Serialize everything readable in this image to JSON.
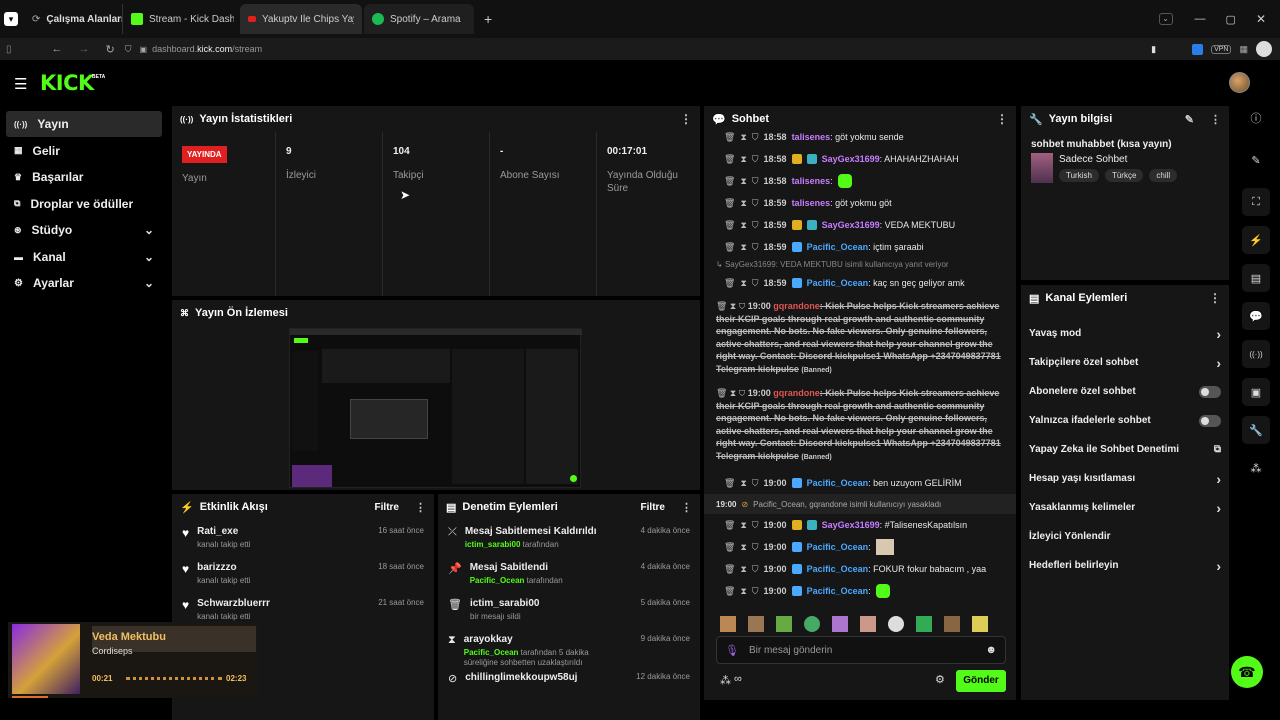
{
  "browser": {
    "tabs": [
      {
        "label": "Çalışma Alanları",
        "color": "#888"
      },
      {
        "label": "Stream - Kick Dashboard",
        "color": "#53fc18"
      },
      {
        "label": "Yakuptv İle Chips Yayında K",
        "color": "#e02020"
      },
      {
        "label": "Spotify – Arama",
        "color": "#1db954"
      }
    ],
    "url_prefix": "dashboard.",
    "url_domain": "kick.com",
    "url_path": "/stream",
    "vpn": "VPN"
  },
  "app": {
    "logo": "KICK",
    "logo_sup": "BETA"
  },
  "sidebar": {
    "items": [
      {
        "label": "Yayın",
        "icon": "broadcast-icon",
        "glyph": "((·))",
        "chev": ""
      },
      {
        "label": "Gelir",
        "icon": "income-icon",
        "glyph": "▦",
        "chev": ""
      },
      {
        "label": "Başarılar",
        "icon": "trophy-icon",
        "glyph": "🏆",
        "chev": ""
      },
      {
        "label": "Droplar ve ödüller",
        "icon": "drops-icon",
        "glyph": "⧉",
        "chev": ""
      },
      {
        "label": "Stüdyo",
        "icon": "studio-icon",
        "glyph": "⊛",
        "chev": "⌄"
      },
      {
        "label": "Kanal",
        "icon": "channel-icon",
        "glyph": "▬",
        "chev": "⌄"
      },
      {
        "label": "Ayarlar",
        "icon": "settings-icon",
        "glyph": "⚙",
        "chev": "⌄"
      }
    ]
  },
  "stats": {
    "title": "Yayın İstatistikleri",
    "live_badge": "YAYINDA",
    "live_label": "Yayın",
    "viewers": "9",
    "viewers_label": "İzleyici",
    "followers": "104",
    "followers_label": "Takipçi",
    "subs": "-",
    "subs_label": "Abone Sayısı",
    "uptime": "00:17:01",
    "uptime_label": "Yayında Olduğu Süre"
  },
  "preview": {
    "title": "Yayın Ön İzlemesi"
  },
  "activity": {
    "title": "Etkinlik Akışı",
    "filter": "Filtre",
    "rows": [
      {
        "name": "Rati_exe",
        "sub": "kanalı takip etti",
        "time": "16 saat önce"
      },
      {
        "name": "barizzzo",
        "sub": "kanalı takip etti",
        "time": "18 saat önce"
      },
      {
        "name": "Schwarzbluerrr",
        "sub": "kanalı takip etti",
        "time": "21 saat önce"
      }
    ]
  },
  "mod": {
    "title": "Denetim Eylemleri",
    "filter": "Filtre",
    "rows": [
      {
        "title": "Mesaj Sabitlemesi Kaldırıldı",
        "who": "ictim_sarabi00",
        "rest": " tarafından",
        "time": "4 dakika önce",
        "icon": "unpin-icon",
        "glyph": "⤫"
      },
      {
        "title": "Mesaj Sabitlendi",
        "who": "Pacific_Ocean",
        "rest": " tarafından",
        "time": "4 dakika önce",
        "icon": "pin-icon",
        "glyph": "⊥"
      },
      {
        "title": "ictim_sarabi00",
        "who": "",
        "rest": "bir mesajı sildi",
        "time": "5 dakika önce",
        "icon": "trash-icon",
        "glyph": "🗑"
      },
      {
        "title": "arayokkay",
        "who": "Pacific_Ocean",
        "rest": " tarafından 5 dakika süreliğine sohbetten uzaklaştırıldı",
        "time": "9 dakika önce",
        "icon": "timeout-icon",
        "glyph": "⧗"
      },
      {
        "title": "chillinglimekkoupw58uj",
        "who": "",
        "rest": "",
        "time": "12 dakika önce",
        "icon": "ban-icon",
        "glyph": "⊘"
      }
    ]
  },
  "player": {
    "title": "Veda Mektubu",
    "artist": "Cordiseps",
    "elapsed": "00:21",
    "total": "02:23",
    "progress": 0.15
  },
  "chat": {
    "title": "Sohbet",
    "lines": [
      {
        "t": "18:58",
        "u": "talisenes",
        "uc": "#c77dff",
        "m": ": göt yokmu sende",
        "b": ""
      },
      {
        "t": "18:58",
        "u": "SayGex31699",
        "uc": "#c77dff",
        "m": ": AHAHAHZHAHAH",
        "b": "crown"
      },
      {
        "t": "18:58",
        "u": "talisenes",
        "uc": "#c77dff",
        "m": ":",
        "b": "",
        "emote": true
      },
      {
        "t": "18:59",
        "u": "talisenes",
        "uc": "#c77dff",
        "m": ": göt yokmu göt",
        "b": ""
      },
      {
        "t": "18:59",
        "u": "SayGex31699",
        "uc": "#c77dff",
        "m": ": VEDA MEKTUBU",
        "b": "crown"
      },
      {
        "t": "18:59",
        "u": "Pacific_Ocean",
        "uc": "#4aa8ff",
        "m": ": içtim şaraabi",
        "b": "sword"
      }
    ],
    "reply_note": "SayGex31699: VEDA MEKTUBU isimli kullanıcıya yanıt veriyor",
    "line7": {
      "t": "18:59",
      "u": "Pacific_Ocean",
      "m": ": kaç sn geç geliyor amk"
    },
    "spam_t": "19:00",
    "spam_u": "gqrandone",
    "spam_text": ": Kick Pulse helps Kick streamers achieve their KCIP goals through real growth and authentic community engagement. No bots. No fake viewers. Only genuine followers, active chatters, and real viewers that help your channel grow the right way. Contact: Discord kickpulse1 WhatsApp +2347049837781 Telegram kickpulse",
    "banned": "(Banned)",
    "line8": {
      "t": "19:00",
      "u": "Pacific_Ocean",
      "m": ": ben uzuyom GELİRİM"
    },
    "ban_notice_t": "19:00",
    "ban_notice": "Pacific_Ocean, gqrandone isimli kullanıcıyı yasakladı",
    "tail": [
      {
        "t": "19:00",
        "u": "SayGex31699",
        "uc": "#c77dff",
        "m": ": #TalisenesKapatılsın",
        "b": "crown",
        "emote": false
      },
      {
        "t": "19:00",
        "u": "Pacific_Ocean",
        "uc": "#4aa8ff",
        "m": ":",
        "b": "sword",
        "emote": "cat"
      },
      {
        "t": "19:00",
        "u": "Pacific_Ocean",
        "uc": "#4aa8ff",
        "m": ": FOKUR fokur babacım , yaa",
        "b": "sword",
        "emote": false
      },
      {
        "t": "19:00",
        "u": "Pacific_Ocean",
        "uc": "#4aa8ff",
        "m": ":",
        "b": "sword",
        "emote": "green"
      }
    ],
    "input_placeholder": "Bir mesaj gönderin",
    "send": "Gönder"
  },
  "info": {
    "title": "Yayın bilgisi",
    "stream_title": "sohbet muhabbet (kısa yayın)",
    "category": "Sadece Sohbet",
    "tags": [
      "Turkish",
      "Türkçe",
      "chill"
    ]
  },
  "actions": {
    "title": "Kanal Eylemleri",
    "rows": [
      {
        "label": "Yavaş mod",
        "kind": "arrow"
      },
      {
        "label": "Takipçilere özel sohbet",
        "kind": "arrow"
      },
      {
        "label": "Abonelere özel sohbet",
        "kind": "toggle"
      },
      {
        "label": "Yalnızca ifadelerle sohbet",
        "kind": "toggle"
      },
      {
        "label": "Yapay Zeka ile Sohbet Denetimi",
        "kind": "ext"
      },
      {
        "label": "Hesap yaşı kısıtlaması",
        "kind": "arrow"
      },
      {
        "label": "Yasaklanmış kelimeler",
        "kind": "arrow"
      },
      {
        "label": "İzleyici Yönlendir",
        "kind": "none"
      },
      {
        "label": "Hedefleri belirleyin",
        "kind": "arrow"
      }
    ]
  },
  "colors": {
    "accent": "#53fc18",
    "live": "#e02020",
    "panel": "#161616"
  }
}
